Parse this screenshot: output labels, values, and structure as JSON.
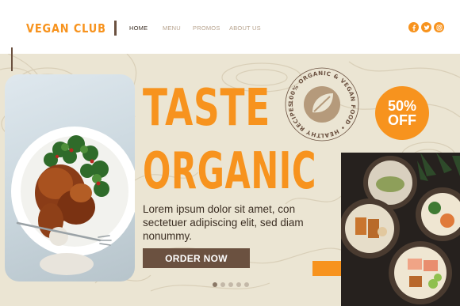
{
  "header": {
    "logo": "VEGAN CLUB",
    "nav": [
      {
        "label": "HOME",
        "active": true
      },
      {
        "label": "MENU",
        "active": false
      },
      {
        "label": "PROMOS",
        "active": false
      },
      {
        "label": "ABOUT US",
        "active": false
      }
    ],
    "socials": [
      "facebook-icon",
      "twitter-icon",
      "instagram-icon"
    ]
  },
  "hero": {
    "title_line1": "TASTE",
    "title_line2": "ORGANIC",
    "body": "Lorem ipsum dolor sit amet, con sectetuer adipiscing elit, sed diam nonummy.",
    "cta_label": "ORDER NOW",
    "stamp_text": "100% ORGANIC & VEGAN FOOD • HEALTHY RECIPES • A •",
    "badge_line1": "50%",
    "badge_line2": "OFF",
    "carousel": {
      "count": 5,
      "active_index": 0
    }
  },
  "colors": {
    "accent": "#f7931e",
    "brown": "#6b5140",
    "cream": "#ebe5d3",
    "text_dark": "#3c2f24"
  }
}
